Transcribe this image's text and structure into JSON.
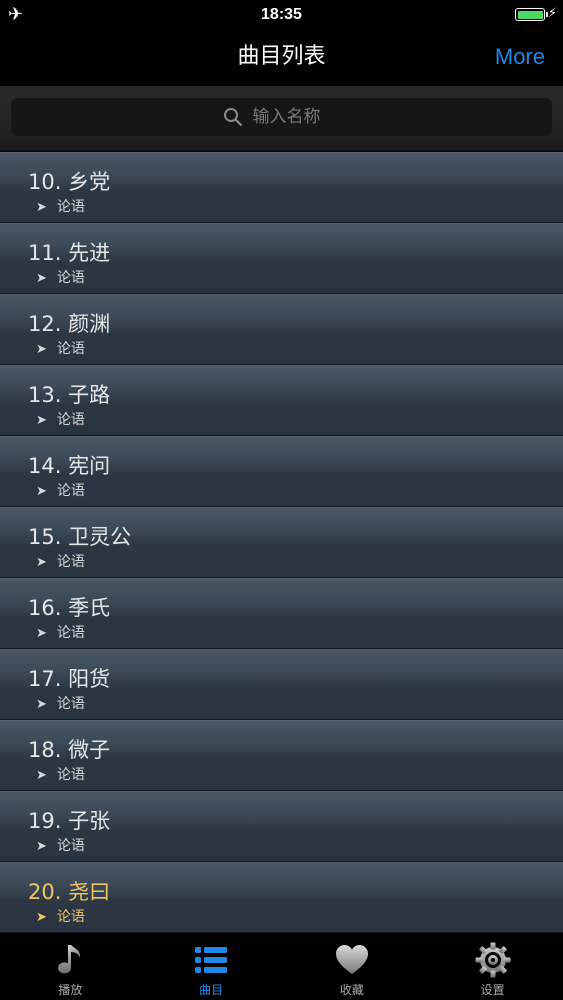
{
  "status_bar": {
    "time": "18:35"
  },
  "nav": {
    "title": "曲目列表",
    "more_label": "More"
  },
  "search": {
    "placeholder": "输入名称"
  },
  "tracks": [
    {
      "title": "10. 乡党",
      "subtitle": "论语"
    },
    {
      "title": "11. 先进",
      "subtitle": "论语"
    },
    {
      "title": "12. 颜渊",
      "subtitle": "论语"
    },
    {
      "title": "13. 子路",
      "subtitle": "论语"
    },
    {
      "title": "14. 宪问",
      "subtitle": "论语"
    },
    {
      "title": "15. 卫灵公",
      "subtitle": "论语"
    },
    {
      "title": "16. 季氏",
      "subtitle": "论语"
    },
    {
      "title": "17. 阳货",
      "subtitle": "论语"
    },
    {
      "title": "18. 微子",
      "subtitle": "论语"
    },
    {
      "title": "19. 子张",
      "subtitle": "论语"
    },
    {
      "title": "20. 尧曰",
      "subtitle": "论语",
      "active": true
    }
  ],
  "tab_bar": {
    "tabs": [
      {
        "label": "播放",
        "icon": "music-note-icon"
      },
      {
        "label": "曲目",
        "icon": "list-icon",
        "active": true
      },
      {
        "label": "收藏",
        "icon": "heart-icon"
      },
      {
        "label": "设置",
        "icon": "gear-icon"
      }
    ]
  },
  "colors": {
    "accent": "#1e88e5",
    "active_track": "#f2c463",
    "battery": "#4cd964"
  }
}
